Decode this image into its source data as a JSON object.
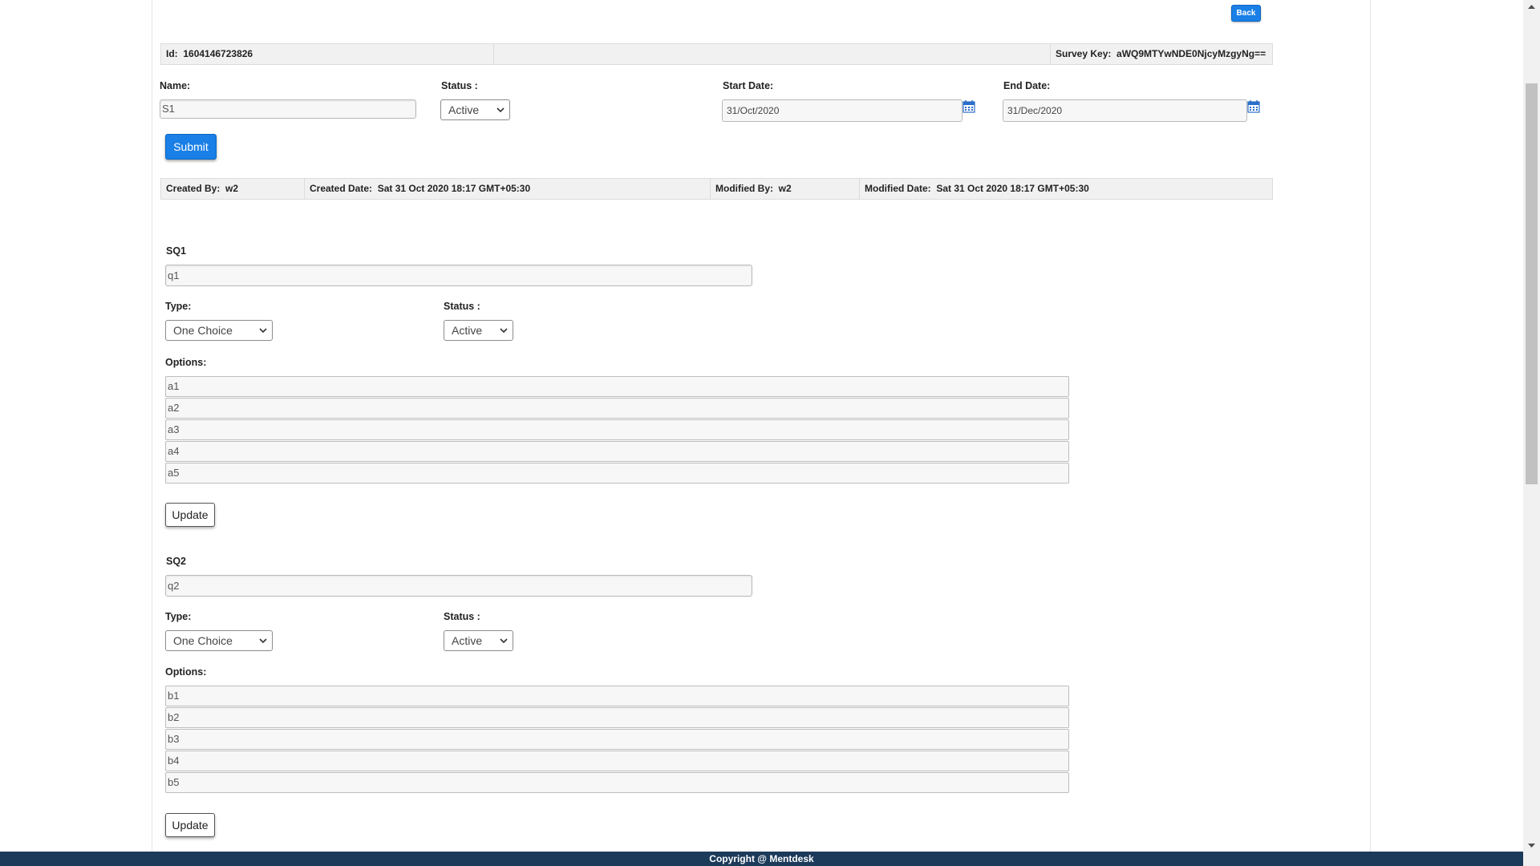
{
  "header": {
    "back_label": "Back"
  },
  "info_bar": {
    "id_label": "Id:",
    "id_value": "1604146723826",
    "survey_key_label": "Survey Key:",
    "survey_key_value": "aWQ9MTYwNDE0NjcyMzgyNg=="
  },
  "survey_form": {
    "name_label": "Name:",
    "name_value": "S1",
    "status_label": "Status :",
    "status_value": "Active",
    "start_date_label": "Start Date:",
    "start_date_value": "31/Oct/2020",
    "end_date_label": "End Date:",
    "end_date_value": "31/Dec/2020",
    "submit_label": "Submit"
  },
  "meta_bar": {
    "created_by_label": "Created By:",
    "created_by_value": "w2",
    "created_date_label": "Created Date:",
    "created_date_value": "Sat 31 Oct 2020 18:17 GMT+05:30",
    "modified_by_label": "Modified By:",
    "modified_by_value": "w2",
    "modified_date_label": "Modified Date:",
    "modified_date_value": "Sat 31 Oct 2020 18:17 GMT+05:30"
  },
  "questions": [
    {
      "heading": "SQ1",
      "question_value": "q1",
      "type_label": "Type:",
      "type_value": "One Choice",
      "status_label": "Status :",
      "status_value": "Active",
      "options_label": "Options:",
      "options": [
        "a1",
        "a2",
        "a3",
        "a4",
        "a5"
      ],
      "update_label": "Update"
    },
    {
      "heading": "SQ2",
      "question_value": "q2",
      "type_label": "Type:",
      "type_value": "One Choice",
      "status_label": "Status :",
      "status_value": "Active",
      "options_label": "Options:",
      "options": [
        "b1",
        "b2",
        "b3",
        "b4",
        "b5"
      ],
      "update_label": "Update"
    }
  ],
  "footer": {
    "copyright": "Copyright @ Mentdesk"
  },
  "colors": {
    "primary_button": "#1a7fe6",
    "footer_bg": "#1c3a5a",
    "info_bar_bg": "#f1f1f1"
  },
  "icons": {
    "calendar": "calendar-icon",
    "dropdown": "chevron-down-icon"
  }
}
